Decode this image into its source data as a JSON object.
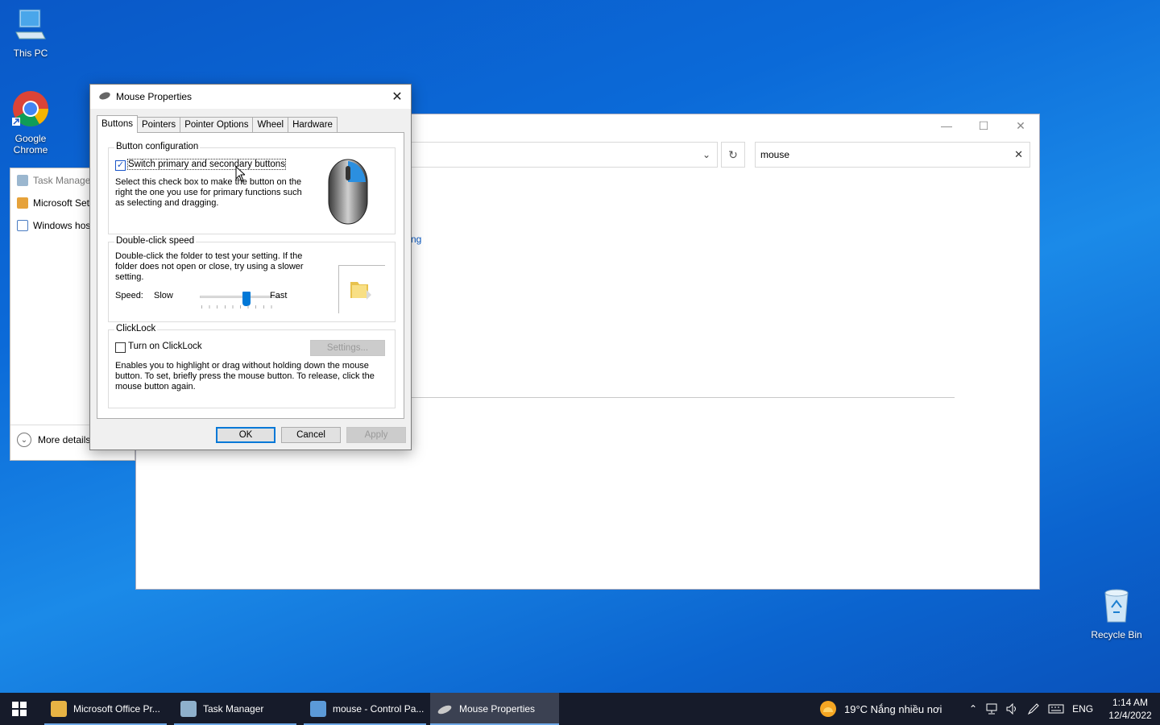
{
  "desktop": {
    "icons": [
      {
        "name": "this-pc",
        "label": "This PC"
      },
      {
        "name": "google-chrome",
        "label": "Google Chrome"
      },
      {
        "name": "recycle-bin",
        "label": "Recycle Bin"
      }
    ]
  },
  "control_panel": {
    "search_value": "mouse",
    "partial_link": "ng"
  },
  "task_manager": {
    "items": [
      "Task Manage",
      "Microsoft Set",
      "Windows hos"
    ],
    "more_details": "More details"
  },
  "mouse_dialog": {
    "title": "Mouse Properties",
    "tabs": [
      "Buttons",
      "Pointers",
      "Pointer Options",
      "Wheel",
      "Hardware"
    ],
    "active_tab": "Buttons",
    "button_config": {
      "label": "Button configuration",
      "checkbox_label": "Switch primary and secondary buttons",
      "checked": true,
      "description": "Select this check box to make the button on the right the one you use for primary functions such as selecting and dragging."
    },
    "double_click": {
      "label": "Double-click speed",
      "description": "Double-click the folder to test your setting. If the folder does not open or close, try using a slower setting.",
      "speed_label": "Speed:",
      "slow_label": "Slow",
      "fast_label": "Fast",
      "speed_fraction": 0.58
    },
    "clicklock": {
      "label": "ClickLock",
      "checkbox_label": "Turn on ClickLock",
      "checked": false,
      "settings_button": "Settings...",
      "description": "Enables you to highlight or drag without holding down the mouse button. To set, briefly press the mouse button. To release, click the mouse button again."
    },
    "buttons": {
      "ok": "OK",
      "cancel": "Cancel",
      "apply": "Apply"
    }
  },
  "taskbar": {
    "apps": [
      {
        "label": "Microsoft Office Pr...",
        "active": false
      },
      {
        "label": "Task Manager",
        "active": false
      },
      {
        "label": "mouse - Control Pa...",
        "active": false
      },
      {
        "label": "Mouse Properties",
        "active": true
      }
    ],
    "weather": "19°C  Nắng nhiều nơi",
    "language": "ENG",
    "time": "1:14 AM",
    "date": "12/4/2022"
  }
}
